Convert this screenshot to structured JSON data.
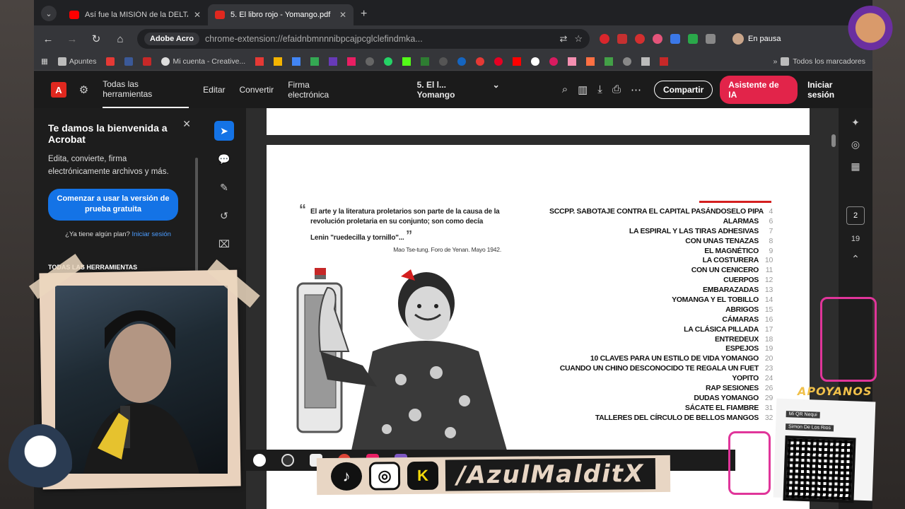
{
  "browser": {
    "tabs": [
      {
        "title": "Así fue la MISIÓN de la DELTA F",
        "favicon_color": "#ff0000",
        "active": false
      },
      {
        "title": "5. El libro rojo - Yomango.pdf",
        "favicon_color": "#e0281f",
        "active": true
      }
    ],
    "omnibox": {
      "site_chip": "Adobe Acro",
      "url": "chrome-extension://efaidnbmnnnibpcajpcglclefindmka..."
    },
    "profile_status": "En pausa",
    "bookmarks": [
      {
        "label": "Apuntes",
        "icon": "folder-icon"
      },
      {
        "label": "Mi cuenta - Creative...",
        "icon": "creative-cloud-icon"
      }
    ],
    "all_bookmarks": "Todos los marcadores"
  },
  "acrobat": {
    "menu": [
      "Todas las herramientas",
      "Editar",
      "Convertir",
      "Firma electrónica"
    ],
    "document_title": "5. El l... Yomango",
    "share_label": "Compartir",
    "ai_label": "Asistente de IA",
    "login_label": "Iniciar sesión",
    "welcome": {
      "title": "Te damos la bienvenida a Acrobat",
      "description": "Edita, convierte, firma electrónicamente archivos y más.",
      "trial_button": "Comenzar a usar la versión de prueba gratuita",
      "plan_question": "¿Ya tiene algún plan?",
      "plan_link": "Iniciar sesión",
      "tools_header": "TODAS LAS HERRAMIENTAS"
    },
    "current_page": "2",
    "total_pages": "19"
  },
  "pdf_page": {
    "quote": "El arte y la literatura proletarios son parte de la causa de la revolución proletaria en su conjunto; son como decía Lenin \"ruedecilla y tornillo\"...",
    "quote_source": "Mao Tse-tung. Foro de Yenan. Mayo 1942.",
    "toc": [
      {
        "title": "SCCPP. SABOTAJE CONTRA EL CAPITAL PASÁNDOSELO PIPA",
        "page": "4"
      },
      {
        "title": "ALARMAS",
        "page": "6"
      },
      {
        "title": "LA ESPIRAL Y LAS TIRAS ADHESIVAS",
        "page": "7"
      },
      {
        "title": "CON UNAS TENAZAS",
        "page": "8"
      },
      {
        "title": "EL MAGNÉTICO",
        "page": "9"
      },
      {
        "title": "LA COSTURERA",
        "page": "10"
      },
      {
        "title": "CON UN CENICERO",
        "page": "11"
      },
      {
        "title": "CUERPOS",
        "page": "12"
      },
      {
        "title": "EMBARAZADAS",
        "page": "13"
      },
      {
        "title": "YOMANGA Y EL TOBILLO",
        "page": "14"
      },
      {
        "title": "ABRIGOS",
        "page": "15"
      },
      {
        "title": "CÁMARAS",
        "page": "16"
      },
      {
        "title": "LA CLÁSICA PILLADA",
        "page": "17"
      },
      {
        "title": "ENTREDEUX",
        "page": "18"
      },
      {
        "title": "ESPEJOS",
        "page": "19"
      },
      {
        "title": "10 CLAVES PARA UN ESTILO DE VIDA YOMANGO",
        "page": "20"
      },
      {
        "title": "CUANDO UN CHINO DESCONOCIDO TE REGALA UN FUET",
        "page": "23"
      },
      {
        "title": "YOPITO",
        "page": "24"
      },
      {
        "title": "RAP SESIONES",
        "page": "26"
      },
      {
        "title": "DUDAS YOMANGO",
        "page": "29"
      },
      {
        "title": "SÁCATE EL FIAMBRE",
        "page": "31"
      },
      {
        "title": "TALLERES DEL CÍRCULO DE BELLOS MANGOS",
        "page": "32"
      }
    ]
  },
  "overlay": {
    "handle": "/AzulMalditX",
    "support_title": "APOYANOS",
    "qr_label": "Mi QR Nequi",
    "qr_name": "Simon De Los Rios",
    "social_k": "K"
  },
  "colors": {
    "acrobat_red": "#e0281f",
    "acrobat_blue": "#1473e6",
    "ai_button": "#e2244a",
    "toc_rule": "#d41f1f"
  }
}
